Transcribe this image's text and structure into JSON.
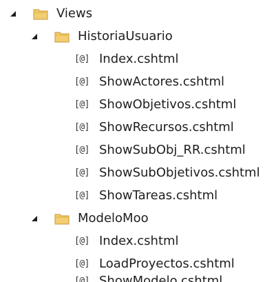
{
  "tree": {
    "views": {
      "label": "Views",
      "expanded": true,
      "children": {
        "historia": {
          "label": "HistoriaUsuario",
          "expanded": true,
          "files": [
            {
              "label": "Index.cshtml",
              "badge": "[@]"
            },
            {
              "label": "ShowActores.cshtml",
              "badge": "[@]"
            },
            {
              "label": "ShowObjetivos.cshtml",
              "badge": "[@]"
            },
            {
              "label": "ShowRecursos.cshtml",
              "badge": "[@]"
            },
            {
              "label": "ShowSubObj_RR.cshtml",
              "badge": "[@]"
            },
            {
              "label": "ShowSubObjetivos.cshtml",
              "badge": "[@]"
            },
            {
              "label": "ShowTareas.cshtml",
              "badge": "[@]"
            }
          ]
        },
        "modelo": {
          "label": "ModeloMoo",
          "expanded": true,
          "files": [
            {
              "label": "Index.cshtml",
              "badge": "[@]"
            },
            {
              "label": "LoadProyectos.cshtml",
              "badge": "[@]"
            },
            {
              "label": "ShowModelo.cshtml",
              "badge": "[@]"
            }
          ]
        }
      }
    }
  },
  "colors": {
    "folder_fill": "#f3cd72",
    "folder_tab": "#e8b94d",
    "folder_stroke": "#c9962f",
    "expander": "#1e1e1e",
    "text": "#1e1e1e"
  },
  "icons": {
    "expander": "expanded-triangle-icon",
    "folder": "folder-icon",
    "file": "razor-file-icon"
  }
}
